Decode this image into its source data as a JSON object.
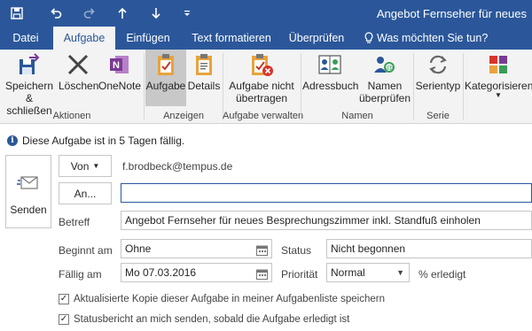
{
  "window": {
    "title": "Angebot Fernseher für neues"
  },
  "quick_access": [
    {
      "name": "save-icon"
    },
    {
      "name": "undo-icon"
    },
    {
      "name": "redo-icon"
    },
    {
      "name": "previous-item-icon"
    },
    {
      "name": "next-item-icon"
    },
    {
      "name": "customize-quick-access-icon"
    }
  ],
  "tabs": [
    "Datei",
    "Aufgabe",
    "Einfügen",
    "Text formatieren",
    "Überprüfen"
  ],
  "active_tab": "Aufgabe",
  "tell_me": "Was möchten Sie tun?",
  "ribbon": {
    "buttons": {
      "save_close": "Speichern\n& schließen",
      "delete": "Löschen",
      "onenote": "OneNote",
      "task": "Aufgabe",
      "details": "Details",
      "assign": "Aufgabe nicht\nübertragen",
      "addressbook": "Adressbuch",
      "check_names": "Namen\nüberprüfen",
      "recurrence": "Serientyp",
      "categorize": "Kategorisieren"
    },
    "groups": {
      "actions": "Aktionen",
      "show": "Anzeigen",
      "manage": "Aufgabe verwalten",
      "names": "Namen",
      "series": "Serie"
    }
  },
  "info": "Diese Aufgabe ist in 5 Tagen fällig.",
  "form": {
    "send_label": "Senden",
    "from_label": "Von",
    "from_value": "f.brodbeck@tempus.de",
    "to_label": "An...",
    "to_value": "",
    "subject_label": "Betreff",
    "subject_value": "Angebot Fernseher für neues Besprechungszimmer inkl. Standfuß einholen",
    "start_label": "Beginnt am",
    "start_value": "Ohne",
    "due_label": "Fällig am",
    "due_value": "Mo 07.03.2016",
    "status_label": "Status",
    "status_value": "Nicht begonnen",
    "priority_label": "Priorität",
    "priority_value": "Normal",
    "percent_label": "% erledigt",
    "keep_copy_label": "Aktualisierte Kopie dieser Aufgabe in meiner Aufgabenliste speichern",
    "keep_copy_checked": true,
    "status_report_label": "Statusbericht an mich senden, sobald die Aufgabe erledigt ist",
    "status_report_checked": true
  },
  "colors": {
    "accent": "#2b579a",
    "ribbon_bg": "#f3f3f3",
    "selected_button": "#c8c8c8"
  }
}
